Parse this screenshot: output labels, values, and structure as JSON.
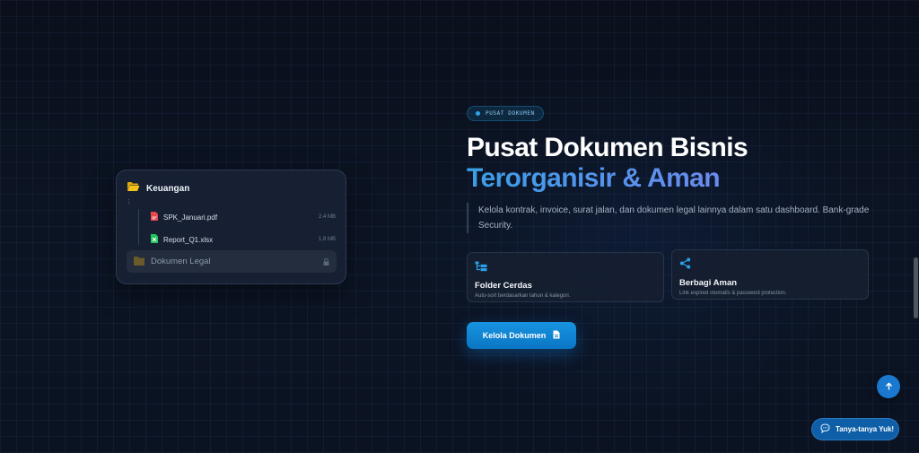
{
  "file_tree": {
    "folder_label": "Keuangan",
    "files": [
      {
        "name": "SPK_Januari.pdf",
        "size": "2.4 MB",
        "icon": "pdf-file-icon"
      },
      {
        "name": "Report_Q1.xlsx",
        "size": "1.8 MB",
        "icon": "excel-file-icon"
      }
    ],
    "locked_folder_label": "Dokumen Legal"
  },
  "hero": {
    "badge": "PUSAT DOKUMEN",
    "title_line1": "Pusat Dokumen Bisnis",
    "title_line2": "Terorganisir & Aman",
    "description": "Kelola kontrak, invoice, surat jalan, dan dokumen legal lainnya dalam satu dashboard. Bank-grade Security."
  },
  "features": [
    {
      "title": "Folder Cerdas",
      "subtitle": "Auto-sort berdasarkan tahun & kategori.",
      "icon": "folder-tree-icon"
    },
    {
      "title": "Berbagi Aman",
      "subtitle": "Link expired otomatis & password protection.",
      "icon": "share-icon"
    }
  ],
  "cta": {
    "label": "Kelola Dokumen",
    "icon": "document-icon"
  },
  "chat_button": {
    "label": "Tanya-tanya Yuk!",
    "icon": "chat-bubble-icon"
  },
  "colors": {
    "background": "#0a1120",
    "accent": "#1893e0",
    "gradient_start": "#3a9ee6",
    "gradient_end": "#8c7af0",
    "folder_yellow": "#f5c21b"
  }
}
